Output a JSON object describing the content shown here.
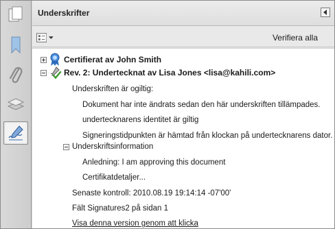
{
  "panel": {
    "title": "Underskrifter"
  },
  "toolbar": {
    "verify_all": "Verifiera alla"
  },
  "tree": {
    "certified": "Certifierat av John Smith",
    "rev2": "Rev. 2: Undertecknat av Lisa Jones <lisa@kahili.com>",
    "invalid": "Underskriften är ogiltig:",
    "modified": "Dokument har inte ändrats sedan den här underskriften tillämpades.",
    "identity": "undertecknarens identitet är giltig",
    "timestamp": "Signeringstidpunkten är hämtad från klockan på undertecknarens dator.",
    "sig_info": "Underskriftsinformation",
    "reason": "Anledning: I am approving this document",
    "cert_details": "Certifikatdetaljer...",
    "last_checked": "Senaste kontroll: 2010.08.19 19:14:14 -07'00'",
    "field": "Fält Signatures2 på sidan 1",
    "view_version": "Visa denna version genom att klicka"
  }
}
